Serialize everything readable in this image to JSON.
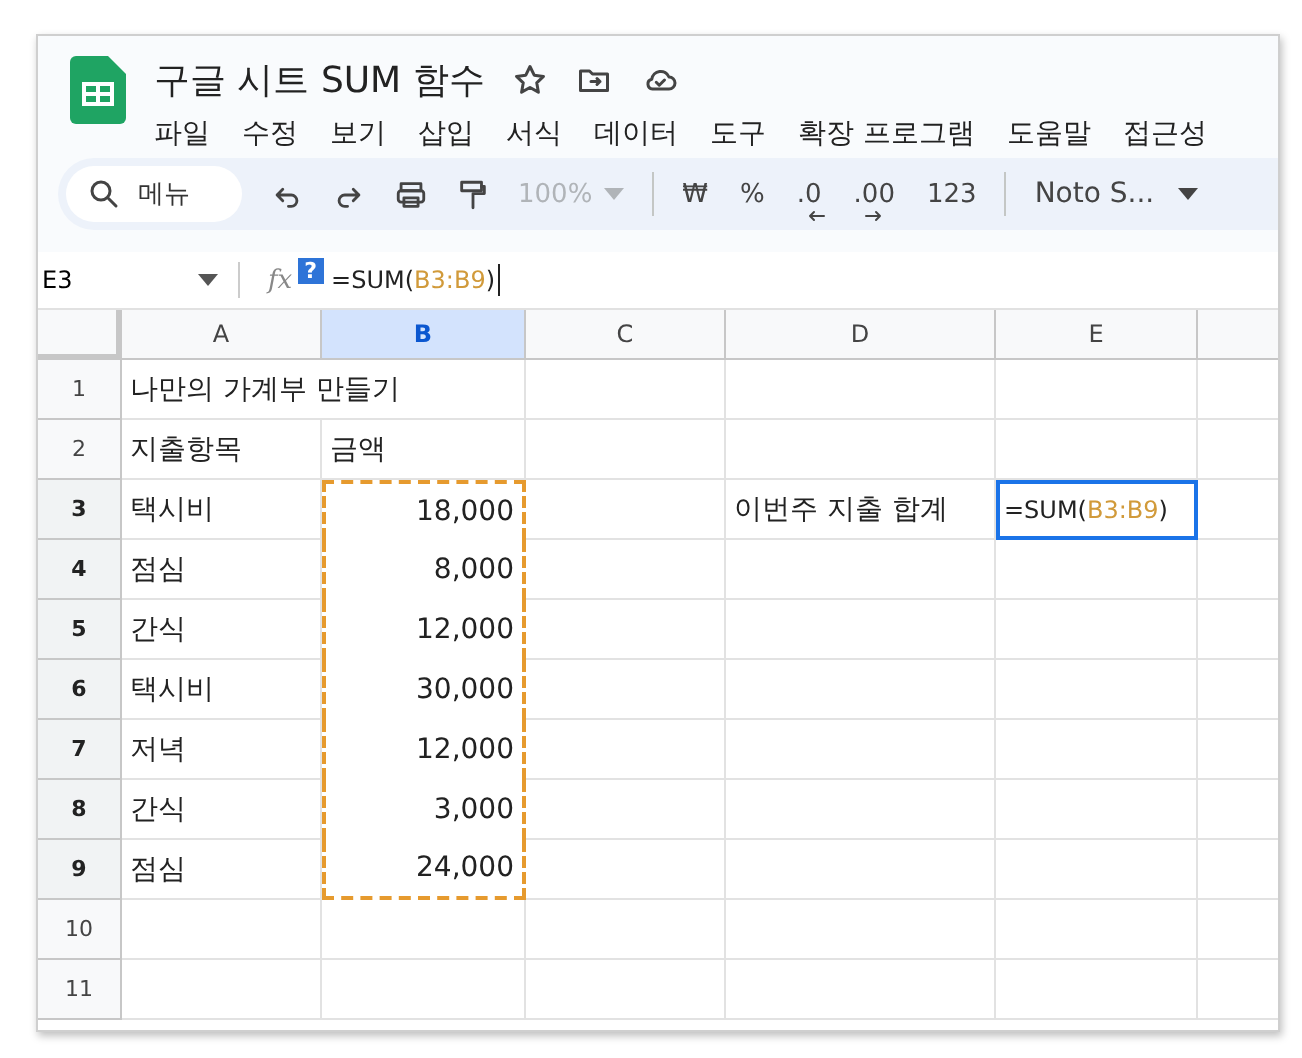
{
  "document": {
    "title": "구글 시트 SUM 함수"
  },
  "menus": [
    "파일",
    "수정",
    "보기",
    "삽입",
    "서식",
    "데이터",
    "도구",
    "확장 프로그램",
    "도움말",
    "접근성"
  ],
  "toolbar": {
    "search_label": "메뉴",
    "zoom": {
      "label": "100%",
      "disabled": true
    },
    "format_buttons": [
      {
        "label": "₩",
        "kind": "plain"
      },
      {
        "label": "%",
        "kind": "plain"
      },
      {
        "label": ".0",
        "kind": "decrease"
      },
      {
        "label": ".00",
        "kind": "increase"
      },
      {
        "label": "123",
        "kind": "plain"
      }
    ],
    "font": "Noto S..."
  },
  "formula_bar": {
    "name_box": "E3",
    "fx_label": "fx",
    "help_badge": "?",
    "formula": [
      {
        "text": "=SUM(",
        "kind": "plain"
      },
      {
        "text": "B3:B9",
        "kind": "range"
      },
      {
        "text": ")",
        "kind": "plain"
      }
    ]
  },
  "grid": {
    "columns": [
      {
        "label": "A",
        "selected": false
      },
      {
        "label": "B",
        "selected": true
      },
      {
        "label": "C",
        "selected": false
      },
      {
        "label": "D",
        "selected": false
      },
      {
        "label": "E",
        "selected": false
      }
    ],
    "rows": [
      {
        "label": "1",
        "selected": false,
        "cells": [
          {
            "kind": "spill_text",
            "text": "나만의 가계부 만들기"
          },
          {
            "kind": "empty"
          },
          {
            "kind": "empty"
          },
          {
            "kind": "empty"
          }
        ]
      },
      {
        "label": "2",
        "selected": false,
        "cells": [
          {
            "kind": "text",
            "text": "지출항목"
          },
          {
            "kind": "text",
            "text": "금액"
          },
          {
            "kind": "empty"
          },
          {
            "kind": "empty"
          },
          {
            "kind": "empty"
          }
        ]
      },
      {
        "label": "3",
        "selected": true,
        "cells": [
          {
            "kind": "text",
            "text": "택시비"
          },
          {
            "kind": "number",
            "text": "18,000",
            "in_range": true
          },
          {
            "kind": "empty"
          },
          {
            "kind": "text",
            "text": "이번주 지출 합계"
          },
          {
            "kind": "formula",
            "active": true,
            "formula": [
              {
                "text": "=SUM(",
                "kind": "plain"
              },
              {
                "text": "B3:B9",
                "kind": "range"
              },
              {
                "text": ")",
                "kind": "plain"
              }
            ]
          }
        ]
      },
      {
        "label": "4",
        "selected": true,
        "cells": [
          {
            "kind": "text",
            "text": "점심"
          },
          {
            "kind": "number",
            "text": "8,000",
            "in_range": true
          },
          {
            "kind": "empty"
          },
          {
            "kind": "empty"
          },
          {
            "kind": "empty"
          }
        ]
      },
      {
        "label": "5",
        "selected": true,
        "cells": [
          {
            "kind": "text",
            "text": "간식"
          },
          {
            "kind": "number",
            "text": "12,000",
            "in_range": true
          },
          {
            "kind": "empty"
          },
          {
            "kind": "empty"
          },
          {
            "kind": "empty"
          }
        ]
      },
      {
        "label": "6",
        "selected": true,
        "cells": [
          {
            "kind": "text",
            "text": "택시비"
          },
          {
            "kind": "number",
            "text": "30,000",
            "in_range": true
          },
          {
            "kind": "empty"
          },
          {
            "kind": "empty"
          },
          {
            "kind": "empty"
          }
        ]
      },
      {
        "label": "7",
        "selected": true,
        "cells": [
          {
            "kind": "text",
            "text": "저녁"
          },
          {
            "kind": "number",
            "text": "12,000",
            "in_range": true
          },
          {
            "kind": "empty"
          },
          {
            "kind": "empty"
          },
          {
            "kind": "empty"
          }
        ]
      },
      {
        "label": "8",
        "selected": true,
        "cells": [
          {
            "kind": "text",
            "text": "간식"
          },
          {
            "kind": "number",
            "text": "3,000",
            "in_range": true
          },
          {
            "kind": "empty"
          },
          {
            "kind": "empty"
          },
          {
            "kind": "empty"
          }
        ]
      },
      {
        "label": "9",
        "selected": true,
        "cells": [
          {
            "kind": "text",
            "text": "점심"
          },
          {
            "kind": "number",
            "text": "24,000",
            "in_range": true
          },
          {
            "kind": "empty"
          },
          {
            "kind": "empty"
          },
          {
            "kind": "empty"
          }
        ]
      },
      {
        "label": "10",
        "selected": false,
        "cells": [
          {
            "kind": "empty"
          },
          {
            "kind": "empty"
          },
          {
            "kind": "empty"
          },
          {
            "kind": "empty"
          },
          {
            "kind": "empty"
          }
        ]
      },
      {
        "label": "11",
        "selected": false,
        "cells": [
          {
            "kind": "empty"
          },
          {
            "kind": "empty"
          },
          {
            "kind": "empty"
          },
          {
            "kind": "empty"
          },
          {
            "kind": "empty"
          }
        ]
      }
    ]
  }
}
